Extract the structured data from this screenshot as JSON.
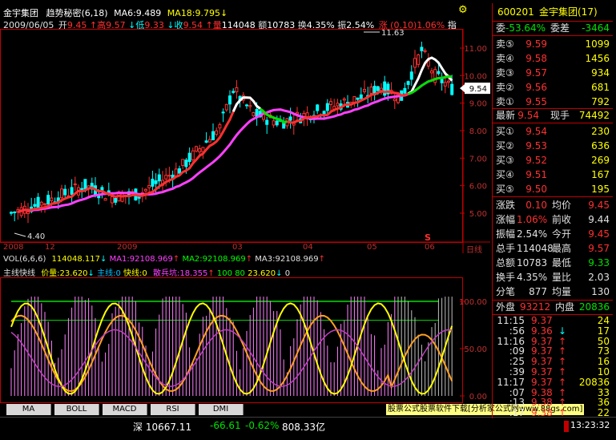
{
  "header": {
    "stock_name": "金宇集团",
    "indicator": "趋势秘密(6,18)",
    "ma6": "MA6:9.489",
    "ma18": "MA18:9.795",
    "ma18_arrow": "↓",
    "settings_icon": "gear-icon"
  },
  "quote_line": {
    "date": "2009/06/05",
    "open_label": "开",
    "open": "9.45",
    "high_label": "↑高",
    "high": "9.57",
    "low_label": "↓低",
    "low": "9.33",
    "close_label": "↓收",
    "close": "9.54",
    "vol_label": "↑量",
    "vol": "114048",
    "amount_label": "额",
    "amount": "10783",
    "turnover_label": "换",
    "turnover": "4.35%",
    "amplitude_label": "振",
    "amplitude": "2.54%",
    "change": "涨 (0.10)1.06%",
    "zhi": "指"
  },
  "price_axis": [
    "11.00",
    "10.00",
    "9.00",
    "8.00",
    "7.00",
    "6.00",
    "5.00"
  ],
  "price_marker": "9.54",
  "max_label": "11.63",
  "min_label": "4.40",
  "date_axis": [
    "2008",
    "12",
    "2009",
    "03",
    "04",
    "05",
    "06"
  ],
  "date_axis_end": "日线",
  "s_marker": "S",
  "vol_line": {
    "title": "VOL(6,6,6)",
    "vol": "114048.117",
    "vol_arrow": "↓",
    "ma1": "MA1:92108.969",
    "ma1_arrow": "↑",
    "ma2": "MA2:92108.969",
    "ma2_arrow": "↑",
    "ma3": "MA3:92108.969",
    "ma3_arrow": "↑"
  },
  "sub_line": {
    "title": "主线快线",
    "price": "价量:23.620",
    "price_arrow": "↓",
    "main": "主线:0",
    "fast": "快线:0",
    "retail": "散兵坑:18.355",
    "retail_arrow": "↑",
    "v100": "100",
    "v80": "80",
    "v2362": "23.620",
    "v2362_arrow": "↓",
    "v0": "0"
  },
  "sub_axis": [
    "100.00",
    "50.00",
    "0.00"
  ],
  "tabs": [
    "MA",
    "BOLL",
    "MACD",
    "RSI",
    "DMI"
  ],
  "status_bar": {
    "index": "深 10667.11",
    "change": "-66.61",
    "pct": "-0.62%",
    "amount": "808.33亿",
    "ad": "股票公式股票软件下载[分析家公式网www.88gs.com]",
    "time": "13:23:32"
  },
  "panel": {
    "code": "600201",
    "name": "金宇集团(17)",
    "weibi_label": "委",
    "weibi": "-53.64%",
    "weicha_label": "委差",
    "weicha": "-3464",
    "sells": [
      {
        "label": "卖⑤",
        "price": "9.59",
        "vol": "1099"
      },
      {
        "label": "卖④",
        "price": "9.58",
        "vol": "1456"
      },
      {
        "label": "卖③",
        "price": "9.57",
        "vol": "934"
      },
      {
        "label": "卖②",
        "price": "9.56",
        "vol": "681"
      },
      {
        "label": "卖①",
        "price": "9.55",
        "vol": "792"
      }
    ],
    "latest_label": "最新",
    "latest": "9.54",
    "current_label": "现手",
    "current": "74492",
    "buys": [
      {
        "label": "买①",
        "price": "9.54",
        "vol": "230"
      },
      {
        "label": "买②",
        "price": "9.53",
        "vol": "636"
      },
      {
        "label": "买③",
        "price": "9.52",
        "vol": "269"
      },
      {
        "label": "买④",
        "price": "9.51",
        "vol": "167"
      },
      {
        "label": "买⑤",
        "price": "9.50",
        "vol": "195"
      }
    ],
    "stats": [
      {
        "l1": "涨跌",
        "v1": "0.10",
        "l2": "均价",
        "v2": "9.45"
      },
      {
        "l1": "涨幅",
        "v1": "1.06%",
        "l2": "前收",
        "v2": "9.44"
      },
      {
        "l1": "振幅",
        "v1": "2.54%",
        "l2": "今开",
        "v2": "9.45"
      },
      {
        "l1": "总手",
        "v1": "114048",
        "l2": "最高",
        "v2": "9.57"
      },
      {
        "l1": "总额",
        "v1": "10783",
        "l2": "最低",
        "v2": "9.33"
      },
      {
        "l1": "换手",
        "v1": "4.35%",
        "l2": "量比",
        "v2": "2.03"
      },
      {
        "l1": "分笔",
        "v1": "877",
        "l2": "均量",
        "v2": "130"
      }
    ],
    "outer_label": "外盘",
    "outer": "93212",
    "inner_label": "内盘",
    "inner": "20836",
    "ticks": [
      {
        "time": "11:15",
        "price": "9.37",
        "arrow": "",
        "vol": "24"
      },
      {
        "time": ":56",
        "price": "9.36",
        "arrow": "↓",
        "vol": "17"
      },
      {
        "time": "11:16",
        "price": "9.37",
        "arrow": "↑",
        "vol": "50"
      },
      {
        "time": ":09",
        "price": "9.37",
        "arrow": "↑",
        "vol": "73"
      },
      {
        "time": ":25",
        "price": "9.37",
        "arrow": "↑",
        "vol": "16"
      },
      {
        "time": ":39",
        "price": "9.37",
        "arrow": "↑",
        "vol": "10"
      },
      {
        "time": "11:17",
        "price": "9.37",
        "arrow": "↑",
        "vol": "20836"
      },
      {
        "time": ":07",
        "price": "9.38",
        "arrow": "↑",
        "vol": "33"
      },
      {
        "time": ":13",
        "price": "9.38",
        "arrow": "↑",
        "vol": "36"
      },
      {
        "time": ":17",
        "price": "9.38",
        "arrow": "↑",
        "vol": "22"
      }
    ]
  },
  "colors": {
    "up": "#ff3030",
    "down": "#00ffff",
    "ma6": "#ffffff",
    "ma18": "#ff40ff",
    "ma18_green": "#00e000",
    "panel_border": "#c00000"
  }
}
